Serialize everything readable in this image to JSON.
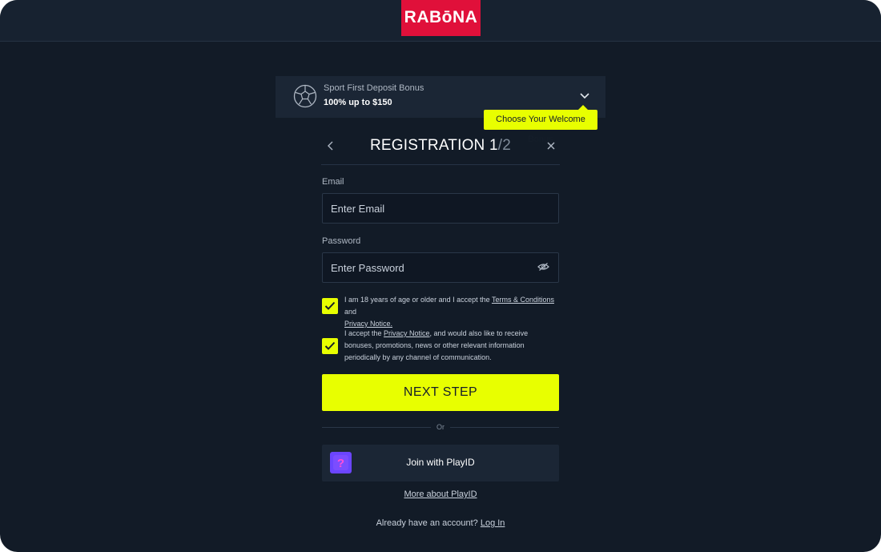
{
  "brand": {
    "logo_text": "RABōNA",
    "accent": "#e8ff00",
    "logo_color": "#e0103a"
  },
  "bonus": {
    "title": "Sport First Deposit Bonus",
    "value": "100% up to $150",
    "icon": "soccer-ball-icon",
    "tooltip": "Choose Your Welcome Bonus"
  },
  "registration": {
    "title": "REGISTRATION",
    "step": "1",
    "total": "/2",
    "email_label": "Email",
    "email_placeholder": "Enter Email",
    "password_label": "Password",
    "password_placeholder": "Enter Password"
  },
  "consents": [
    {
      "checked": true,
      "text_before": "I am 18 years of age or older and I accept the ",
      "link1": "Terms & Conditions",
      "text_middle": " and ",
      "link2": "Privacy Notice.",
      "text_after": ""
    },
    {
      "checked": true,
      "text_before": "I accept the ",
      "link1": "Privacy Notice",
      "text_middle": ", and would also like to receive bonuses, promotions, news or other relevant information periodically by any channel of communication.",
      "link2": "",
      "text_after": ""
    }
  ],
  "actions": {
    "next_label": "NEXT STEP",
    "or_label": "Or",
    "playid_label": "Join with PlayID",
    "more_playid": "More about PlayID",
    "login_prompt": "Already have an account?",
    "login_link": "Log In"
  }
}
